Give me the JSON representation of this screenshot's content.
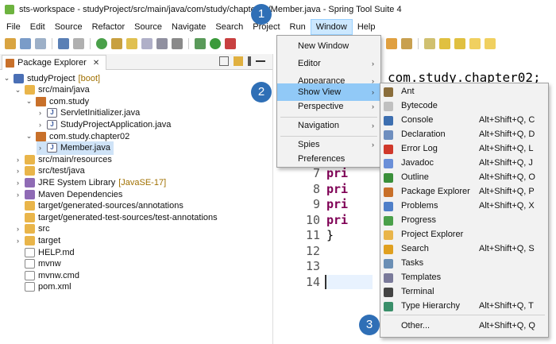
{
  "window": {
    "title": "sts-workspace - studyProject/src/main/java/com/study/chapter02/Member.java - Spring Tool Suite 4"
  },
  "menubar": [
    "File",
    "Edit",
    "Source",
    "Refactor",
    "Source",
    "Navigate",
    "Search",
    "Project",
    "Run",
    "Window",
    "Help"
  ],
  "package_explorer": {
    "tab_label": "Package Explorer",
    "close_glyph": "✕",
    "tree": [
      {
        "label": "studyProject",
        "suffix": " [boot]",
        "icon": "project-icon",
        "chev": "⌄"
      },
      {
        "label": "src/main/java",
        "suffix": "",
        "icon": "folder-icon",
        "chev": "⌄"
      },
      {
        "label": "com.study",
        "suffix": "",
        "icon": "package-icon",
        "chev": "⌄"
      },
      {
        "label": "ServletInitializer.java",
        "suffix": "",
        "icon": "java-file-icon",
        "chev": "›"
      },
      {
        "label": "StudyProjectApplication.java",
        "suffix": "",
        "icon": "java-file-icon",
        "chev": "›"
      },
      {
        "label": "com.study.chapter02",
        "suffix": "",
        "icon": "package-icon",
        "chev": "⌄"
      },
      {
        "label": "Member.java",
        "suffix": "",
        "icon": "java-file-icon",
        "chev": "›"
      },
      {
        "label": "src/main/resources",
        "suffix": "",
        "icon": "folder-icon",
        "chev": "›"
      },
      {
        "label": "src/test/java",
        "suffix": "",
        "icon": "folder-icon",
        "chev": "›"
      },
      {
        "label": "JRE System Library",
        "suffix": " [JavaSE-17]",
        "icon": "library-icon",
        "chev": "›"
      },
      {
        "label": "Maven Dependencies",
        "suffix": "",
        "icon": "library-icon",
        "chev": "›"
      },
      {
        "label": "target/generated-sources/annotations",
        "suffix": "",
        "icon": "folder-icon",
        "chev": ""
      },
      {
        "label": "target/generated-test-sources/test-annotations",
        "suffix": "",
        "icon": "folder-icon",
        "chev": ""
      },
      {
        "label": "src",
        "suffix": "",
        "icon": "folder-icon",
        "chev": "›"
      },
      {
        "label": "target",
        "suffix": "",
        "icon": "folder-icon",
        "chev": "›"
      },
      {
        "label": "HELP.md",
        "suffix": "",
        "icon": "markdown-file-icon",
        "chev": ""
      },
      {
        "label": "mvnw",
        "suffix": "",
        "icon": "file-icon",
        "chev": ""
      },
      {
        "label": "mvnw.cmd",
        "suffix": "",
        "icon": "file-icon",
        "chev": ""
      },
      {
        "label": "pom.xml",
        "suffix": "",
        "icon": "xml-file-icon",
        "chev": ""
      }
    ]
  },
  "editor": {
    "header_code": "com.study.chapter02;",
    "lines": [
      {
        "n": "7",
        "code": "pri"
      },
      {
        "n": "8",
        "code": "pri"
      },
      {
        "n": "9",
        "code": "pri"
      },
      {
        "n": "10",
        "code": "pri"
      },
      {
        "n": "11",
        "code": "}"
      },
      {
        "n": "12",
        "code": ""
      },
      {
        "n": "13",
        "code": ""
      },
      {
        "n": "14",
        "code": ""
      }
    ]
  },
  "window_menu": [
    {
      "label": "New Window",
      "arrow": ""
    },
    {
      "label": "Editor",
      "arrow": "›"
    },
    {
      "label": "Appearance",
      "arrow": "›"
    },
    {
      "label": "Show View",
      "arrow": "›"
    },
    {
      "label": "Perspective",
      "arrow": "›"
    },
    {
      "label": "Navigation",
      "arrow": "›"
    },
    {
      "label": "Spies",
      "arrow": "›"
    },
    {
      "label": "Preferences",
      "arrow": ""
    }
  ],
  "show_view_menu": [
    {
      "label": "Ant",
      "shortcut": "",
      "icon": "ant-icon",
      "color": "#8a6d3b"
    },
    {
      "label": "Bytecode",
      "shortcut": "",
      "icon": "bytecode-icon",
      "color": "#c0c0c0"
    },
    {
      "label": "Console",
      "shortcut": "Alt+Shift+Q, C",
      "icon": "console-icon",
      "color": "#3d6fb0"
    },
    {
      "label": "Declaration",
      "shortcut": "Alt+Shift+Q, D",
      "icon": "declaration-icon",
      "color": "#6f8fbf"
    },
    {
      "label": "Error Log",
      "shortcut": "Alt+Shift+Q, L",
      "icon": "error-log-icon",
      "color": "#d0392b"
    },
    {
      "label": "Javadoc",
      "shortcut": "Alt+Shift+Q, J",
      "icon": "javadoc-icon",
      "color": "#6a8fd8"
    },
    {
      "label": "Outline",
      "shortcut": "Alt+Shift+Q, O",
      "icon": "outline-icon",
      "color": "#3a8f3a"
    },
    {
      "label": "Package Explorer",
      "shortcut": "Alt+Shift+Q, P",
      "icon": "package-explorer-icon",
      "color": "#c8702a"
    },
    {
      "label": "Problems",
      "shortcut": "Alt+Shift+Q, X",
      "icon": "problems-icon",
      "color": "#4f7fc8"
    },
    {
      "label": "Progress",
      "shortcut": "",
      "icon": "progress-icon",
      "color": "#4aa04a"
    },
    {
      "label": "Project Explorer",
      "shortcut": "",
      "icon": "project-explorer-icon",
      "color": "#e9b54a"
    },
    {
      "label": "Search",
      "shortcut": "Alt+Shift+Q, S",
      "icon": "search-icon",
      "color": "#e0a020"
    },
    {
      "label": "Tasks",
      "shortcut": "",
      "icon": "tasks-icon",
      "color": "#6b8fb5"
    },
    {
      "label": "Templates",
      "shortcut": "",
      "icon": "templates-icon",
      "color": "#7a7a9a"
    },
    {
      "label": "Terminal",
      "shortcut": "",
      "icon": "terminal-icon",
      "color": "#444444"
    },
    {
      "label": "Type Hierarchy",
      "shortcut": "Alt+Shift+Q, T",
      "icon": "type-hierarchy-icon",
      "color": "#3a8f6a"
    },
    {
      "label": "Other...",
      "shortcut": "Alt+Shift+Q, Q",
      "icon": "",
      "color": ""
    }
  ],
  "callouts": [
    "1",
    "2",
    "3"
  ],
  "colors": {
    "callout": "#2f6fb6",
    "menu_highlight": "#91c9f7",
    "active_menu": "#cce8ff"
  }
}
